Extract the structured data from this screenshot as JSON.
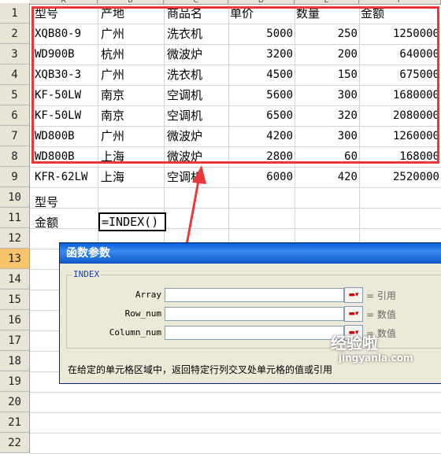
{
  "rows": [
    "1",
    "2",
    "3",
    "4",
    "5",
    "6",
    "7",
    "8",
    "9",
    "10",
    "11",
    "12",
    "13",
    "14",
    "15",
    "16",
    "17",
    "18",
    "19",
    "20",
    "21",
    "22"
  ],
  "columns": [
    "A",
    "B",
    "C",
    "D",
    "E",
    "F"
  ],
  "table": {
    "headers": [
      "型号",
      "产地",
      "商品名",
      "单价",
      "数量",
      "金额"
    ],
    "data": [
      [
        "XQB80-9",
        "广州",
        "洗衣机",
        "5000",
        "250",
        "1250000"
      ],
      [
        "WD900B",
        "杭州",
        "微波炉",
        "3200",
        "200",
        "640000"
      ],
      [
        "XQB30-3",
        "广州",
        "洗衣机",
        "4500",
        "150",
        "675000"
      ],
      [
        "KF-50LW",
        "南京",
        "空调机",
        "5600",
        "300",
        "1680000"
      ],
      [
        "KF-50LW",
        "南京",
        "空调机",
        "6500",
        "320",
        "2080000"
      ],
      [
        "WD800B",
        "广州",
        "微波炉",
        "4200",
        "300",
        "1260000"
      ],
      [
        "WD800B",
        "上海",
        "微波炉",
        "2800",
        "60",
        "168000"
      ],
      [
        "KFR-62LW",
        "上海",
        "空调机",
        "6000",
        "420",
        "2520000"
      ]
    ]
  },
  "lookup": {
    "label_model": "型号",
    "label_amount": "金额",
    "formula": "=INDEX()"
  },
  "dialog": {
    "title": "函数参数",
    "group": "INDEX",
    "args": [
      {
        "label": "Array",
        "result": "= 引用"
      },
      {
        "label": "Row_num",
        "result": "= 数值"
      },
      {
        "label": "Column_num",
        "result": "= 数值"
      }
    ],
    "description": "在给定的单元格区域中，返回特定行列交叉处单元格的值或引用"
  },
  "watermark": {
    "main": "经验啦",
    "sub": "jingyanla.com"
  },
  "colors": {
    "highlight_box": "#e8383a",
    "arrow": "#e8383a",
    "titlebar": "#0a5fd8"
  }
}
